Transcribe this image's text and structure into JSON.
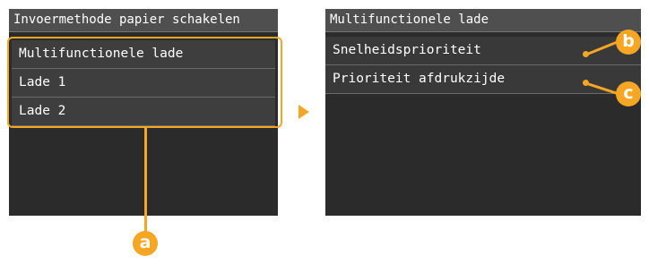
{
  "left_screen": {
    "title": "Invoermethode papier schakelen",
    "items": [
      {
        "label": "Multifunctionele lade"
      },
      {
        "label": "Lade 1"
      },
      {
        "label": "Lade 2"
      }
    ]
  },
  "right_screen": {
    "title": "Multifunctionele lade",
    "items": [
      {
        "label": "Snelheidsprioriteit"
      },
      {
        "label": "Prioriteit afdrukzijde"
      }
    ]
  },
  "callouts": {
    "a": "a",
    "b": "b",
    "c": "c"
  },
  "colors": {
    "accent": "#f5a623",
    "screen_bg": "#2b2b2b",
    "header_bg": "#4f4f4f"
  }
}
